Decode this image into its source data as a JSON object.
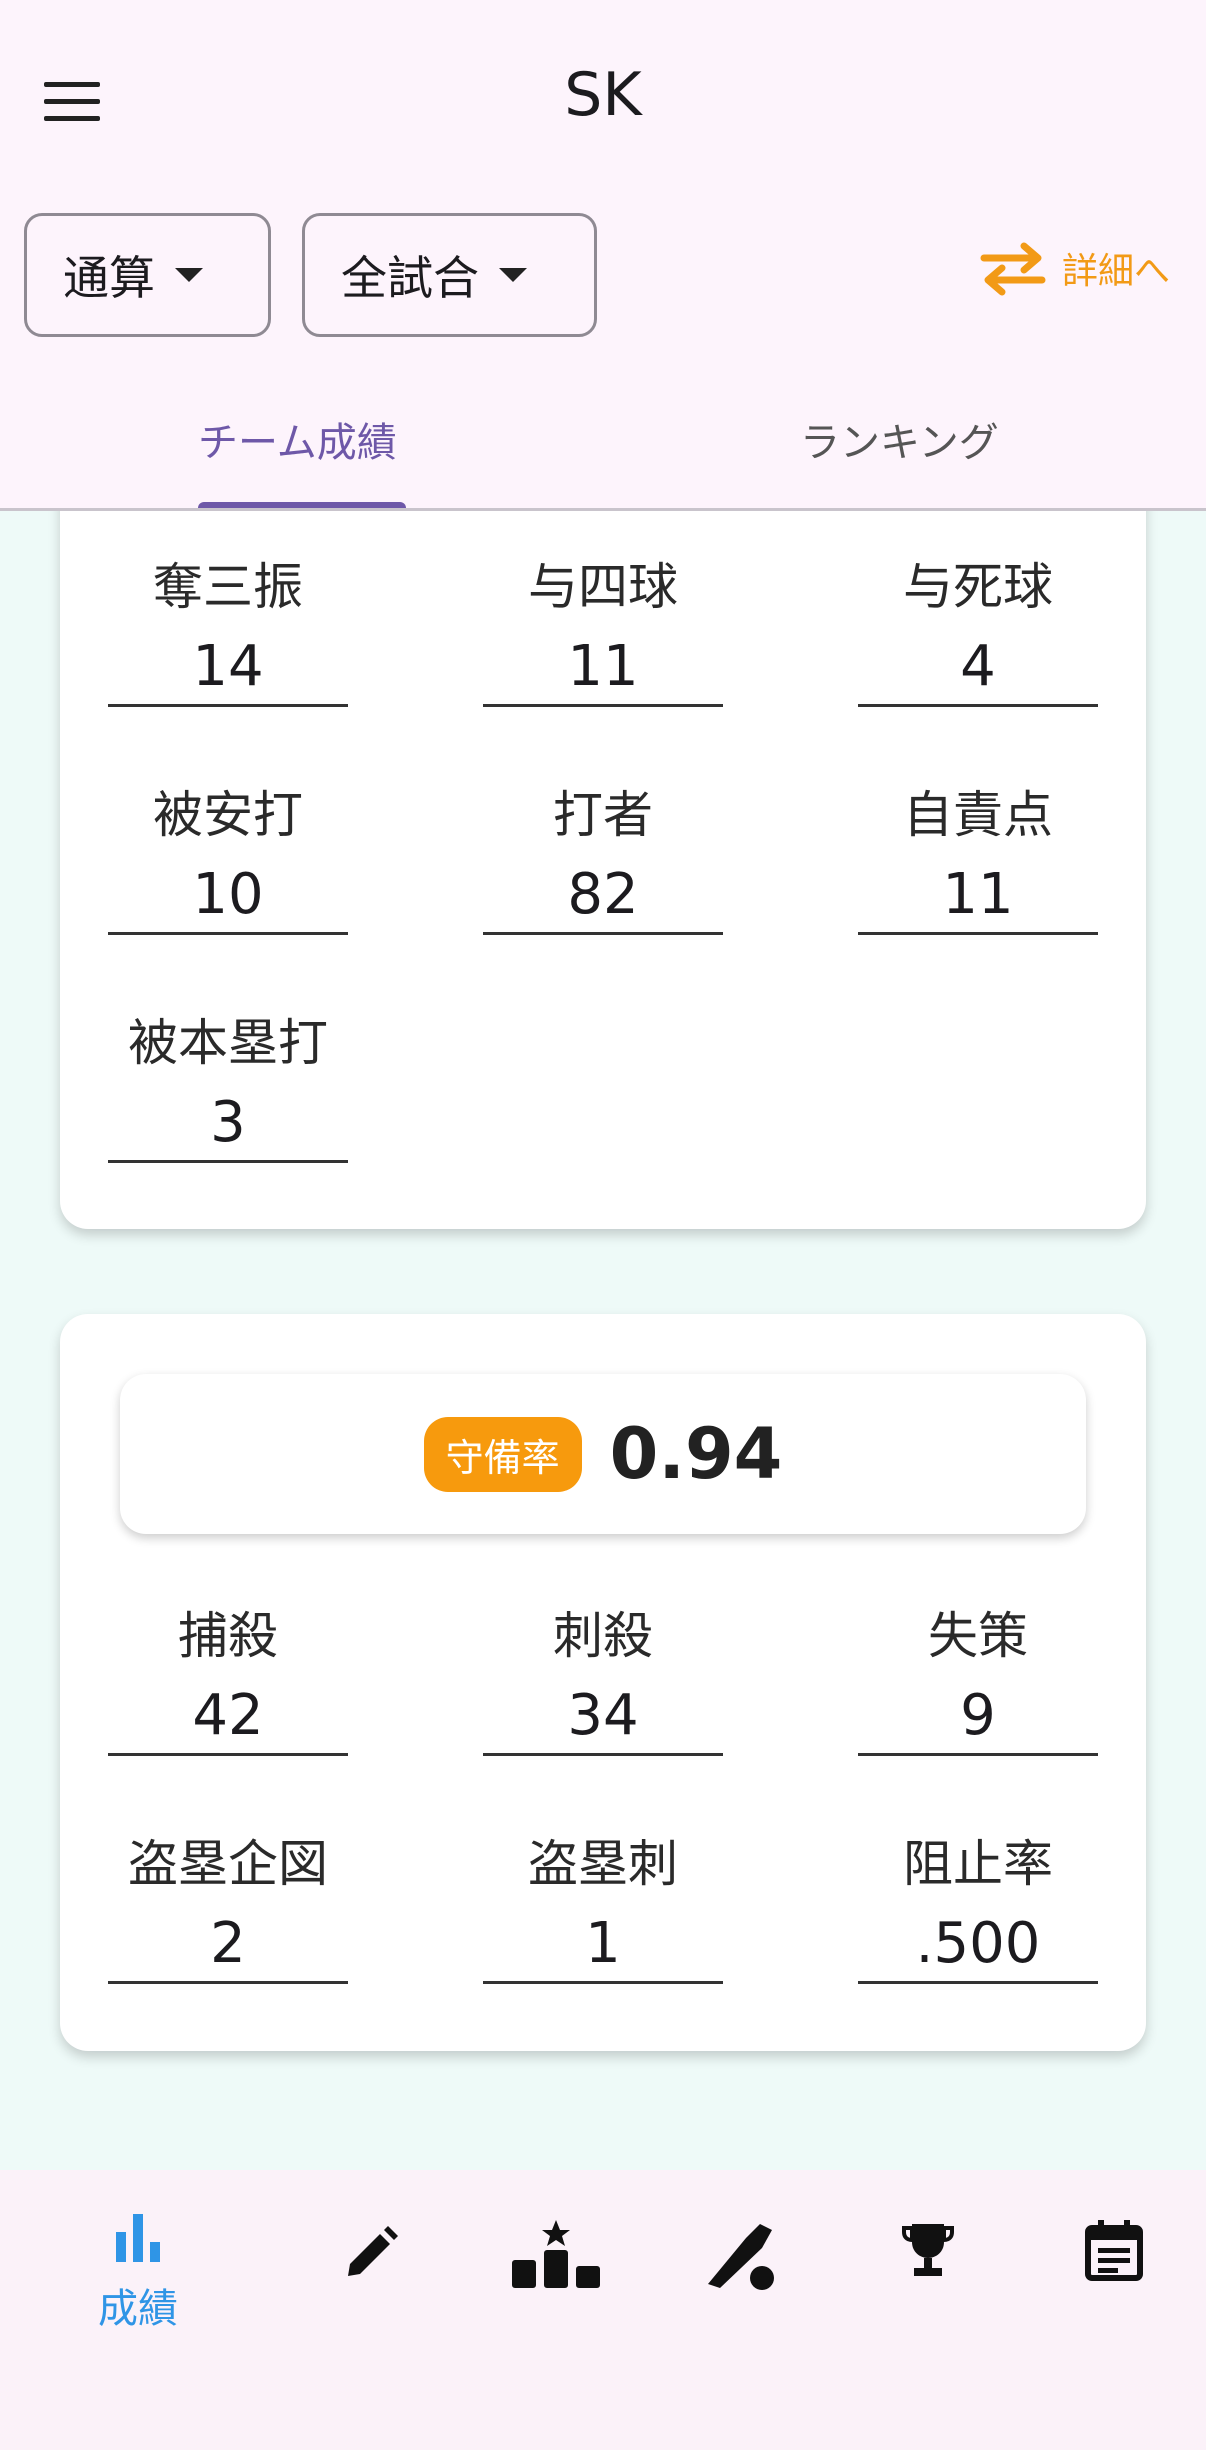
{
  "header": {
    "title": "SK",
    "menu_icon": "menu-icon"
  },
  "filters": {
    "period": "通算",
    "games": "全試合",
    "detail_label": "詳細へ",
    "accent": "#f29a16"
  },
  "tabs": [
    {
      "label": "チーム成績",
      "active": true
    },
    {
      "label": "ランキング",
      "active": false
    }
  ],
  "pitching": [
    {
      "label": "奪三振",
      "value": "14"
    },
    {
      "label": "与四球",
      "value": "11"
    },
    {
      "label": "与死球",
      "value": "4"
    },
    {
      "label": "被安打",
      "value": "10"
    },
    {
      "label": "打者",
      "value": "82"
    },
    {
      "label": "自責点",
      "value": "11"
    },
    {
      "label": "被本塁打",
      "value": "3"
    }
  ],
  "fielding": {
    "badge": "守備率",
    "rate": "0.94",
    "stats": [
      {
        "label": "捕殺",
        "value": "42"
      },
      {
        "label": "刺殺",
        "value": "34"
      },
      {
        "label": "失策",
        "value": "9"
      },
      {
        "label": "盗塁企図",
        "value": "2"
      },
      {
        "label": "盗塁刺",
        "value": "1"
      },
      {
        "label": "阻止率",
        "value": ".500"
      }
    ]
  },
  "bottom_nav": {
    "active_label": "成績",
    "active_color": "#2f95e6",
    "icons": [
      "bar-chart-icon",
      "pencil-icon",
      "podium-icon",
      "bat-icon",
      "trophy-icon",
      "calendar-icon"
    ]
  }
}
